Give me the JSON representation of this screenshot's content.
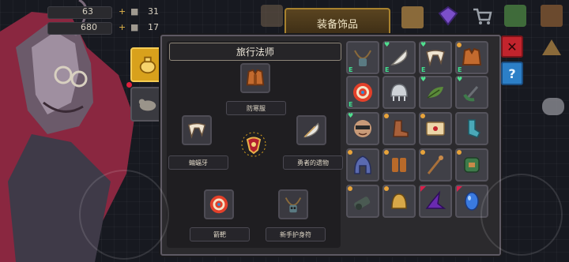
{
  "hud": {
    "stat1_value": "63",
    "stat2_value": "680",
    "stat3_value": "31",
    "stat4_value": "17"
  },
  "tab": {
    "title": "装备饰品"
  },
  "panel": {
    "class_name": "旅行法师",
    "slots": {
      "top": {
        "label": "防寒服",
        "icon": "vest-icon"
      },
      "left": {
        "label": "蝙蝠牙",
        "icon": "fang-icon"
      },
      "center": {
        "icon": "amulet-icon"
      },
      "right": {
        "label": "勇者的遗物",
        "icon": "feather-icon"
      },
      "bottom_left": {
        "label": "箭靶",
        "icon": "target-icon"
      },
      "bottom_right": {
        "label": "新手护身符",
        "icon": "necklace-icon"
      }
    }
  },
  "inventory": {
    "rows": [
      [
        "necklace-icon",
        "feather-icon",
        "fang-icon",
        "vest-icon"
      ],
      [
        "target-icon",
        "helmet-icon",
        "leaf-icon",
        "scythe-icon"
      ],
      [
        "mask-icon",
        "boot-icon",
        "scroll-icon",
        "sock-icon"
      ],
      [
        "hood-icon",
        "gauntlet-icon",
        "staff-icon",
        "pack-icon"
      ],
      [
        "cannon-icon",
        "bell-icon",
        "witch-hat-icon",
        "crystal-icon"
      ]
    ]
  },
  "buttons": {
    "close": "✕",
    "help": "?"
  },
  "colors": {
    "panel_bg": "#2b2a2d",
    "accent_gold": "#d8a11c",
    "close_red": "#c2242d",
    "help_blue": "#2c7fc7",
    "badge_green": "#3fe08f"
  }
}
